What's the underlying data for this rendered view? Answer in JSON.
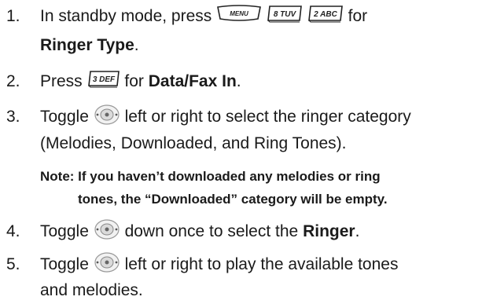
{
  "steps": [
    {
      "number": "1.",
      "text_before": "In standby mode, press",
      "keys": [
        "MENU",
        "8 TUV",
        "2 ABC"
      ],
      "text_after": "for",
      "bold_line2": "Ringer Type",
      "end": "."
    },
    {
      "number": "2.",
      "text_before": "Press",
      "key": "3 DEF",
      "text_after": "for",
      "bold": "Data/Fax In",
      "end": "."
    },
    {
      "number": "3.",
      "text_before": "Toggle",
      "icon": "navigation-key",
      "text_after": "left or right to select the ringer category",
      "line2": "(Melodies, Downloaded, and Ring Tones)."
    },
    {
      "number": "4.",
      "text_before": "Toggle",
      "icon": "navigation-key",
      "text_after": "down once to select the",
      "bold": "Ringer",
      "end": "."
    },
    {
      "number": "5.",
      "text_before": "Toggle",
      "icon": "navigation-key",
      "text_after": "left or right to play the available tones",
      "line2": "and melodies."
    }
  ],
  "note": {
    "line1": "Note: If you haven’t downloaded any melodies or ring",
    "line2": "tones, the “Downloaded” category will be empty."
  }
}
